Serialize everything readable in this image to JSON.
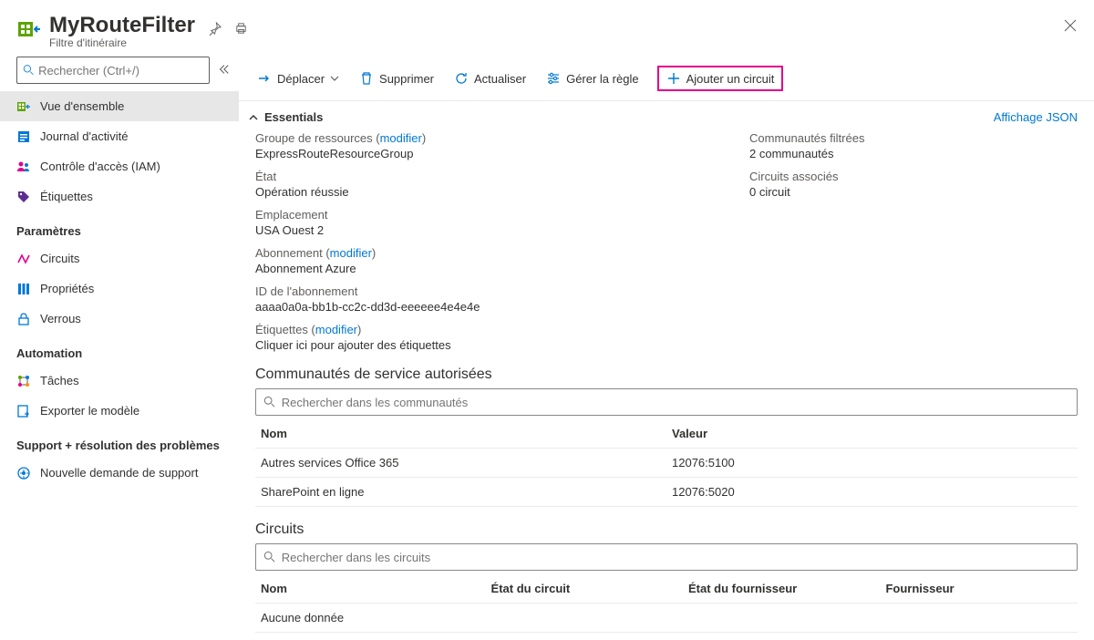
{
  "header": {
    "title": "MyRouteFilter",
    "subtitle": "Filtre d'itinéraire"
  },
  "sidebar": {
    "search_placeholder": "Rechercher (Ctrl+/)",
    "items_main": [
      {
        "label": "Vue d'ensemble"
      },
      {
        "label": "Journal d'activité"
      },
      {
        "label": "Contrôle d'accès (IAM)"
      },
      {
        "label": "Étiquettes"
      }
    ],
    "section_params": "Paramètres",
    "items_params": [
      {
        "label": "Circuits"
      },
      {
        "label": "Propriétés"
      },
      {
        "label": "Verrous"
      }
    ],
    "section_auto": "Automation",
    "items_auto": [
      {
        "label": "Tâches"
      },
      {
        "label": "Exporter le modèle"
      }
    ],
    "section_support": "Support + résolution des problèmes",
    "items_support": [
      {
        "label": "Nouvelle demande de support"
      }
    ]
  },
  "toolbar": {
    "move": "Déplacer",
    "delete": "Supprimer",
    "refresh": "Actualiser",
    "manage_rule": "Gérer la règle",
    "add_circuit": "Ajouter un circuit"
  },
  "essentials": {
    "label": "Essentials",
    "json_view": "Affichage JSON",
    "rg_label": "Groupe de ressources (",
    "modifier": "modifier",
    "rg_value": "ExpressRouteResourceGroup",
    "state_label": "État",
    "state_value": "Opération réussie",
    "loc_label": "Emplacement",
    "loc_value": "USA Ouest 2",
    "sub_label": "Abonnement (",
    "sub_value": "Abonnement Azure",
    "subid_label": "ID de l'abonnement",
    "subid_value": "aaaa0a0a-bb1b-cc2c-dd3d-eeeeee4e4e4e",
    "tags_label": "Étiquettes (",
    "tags_value": "Cliquer ici pour ajouter des étiquettes",
    "comm_label": "Communautés filtrées",
    "comm_value": "2 communautés",
    "circ_label": "Circuits associés",
    "circ_value": "0 circuit"
  },
  "communities": {
    "title": "Communautés de service autorisées",
    "search_placeholder": "Rechercher dans les communautés",
    "col_name": "Nom",
    "col_value": "Valeur",
    "rows": [
      {
        "name": "Autres services Office 365",
        "value": "12076:5100"
      },
      {
        "name": "SharePoint en ligne",
        "value": "12076:5020"
      }
    ]
  },
  "circuits": {
    "title": "Circuits",
    "search_placeholder": "Rechercher dans les circuits",
    "col_name": "Nom",
    "col_state": "État du circuit",
    "col_provider_state": "État du fournisseur",
    "col_provider": "Fournisseur",
    "nodata": "Aucune donnée"
  }
}
